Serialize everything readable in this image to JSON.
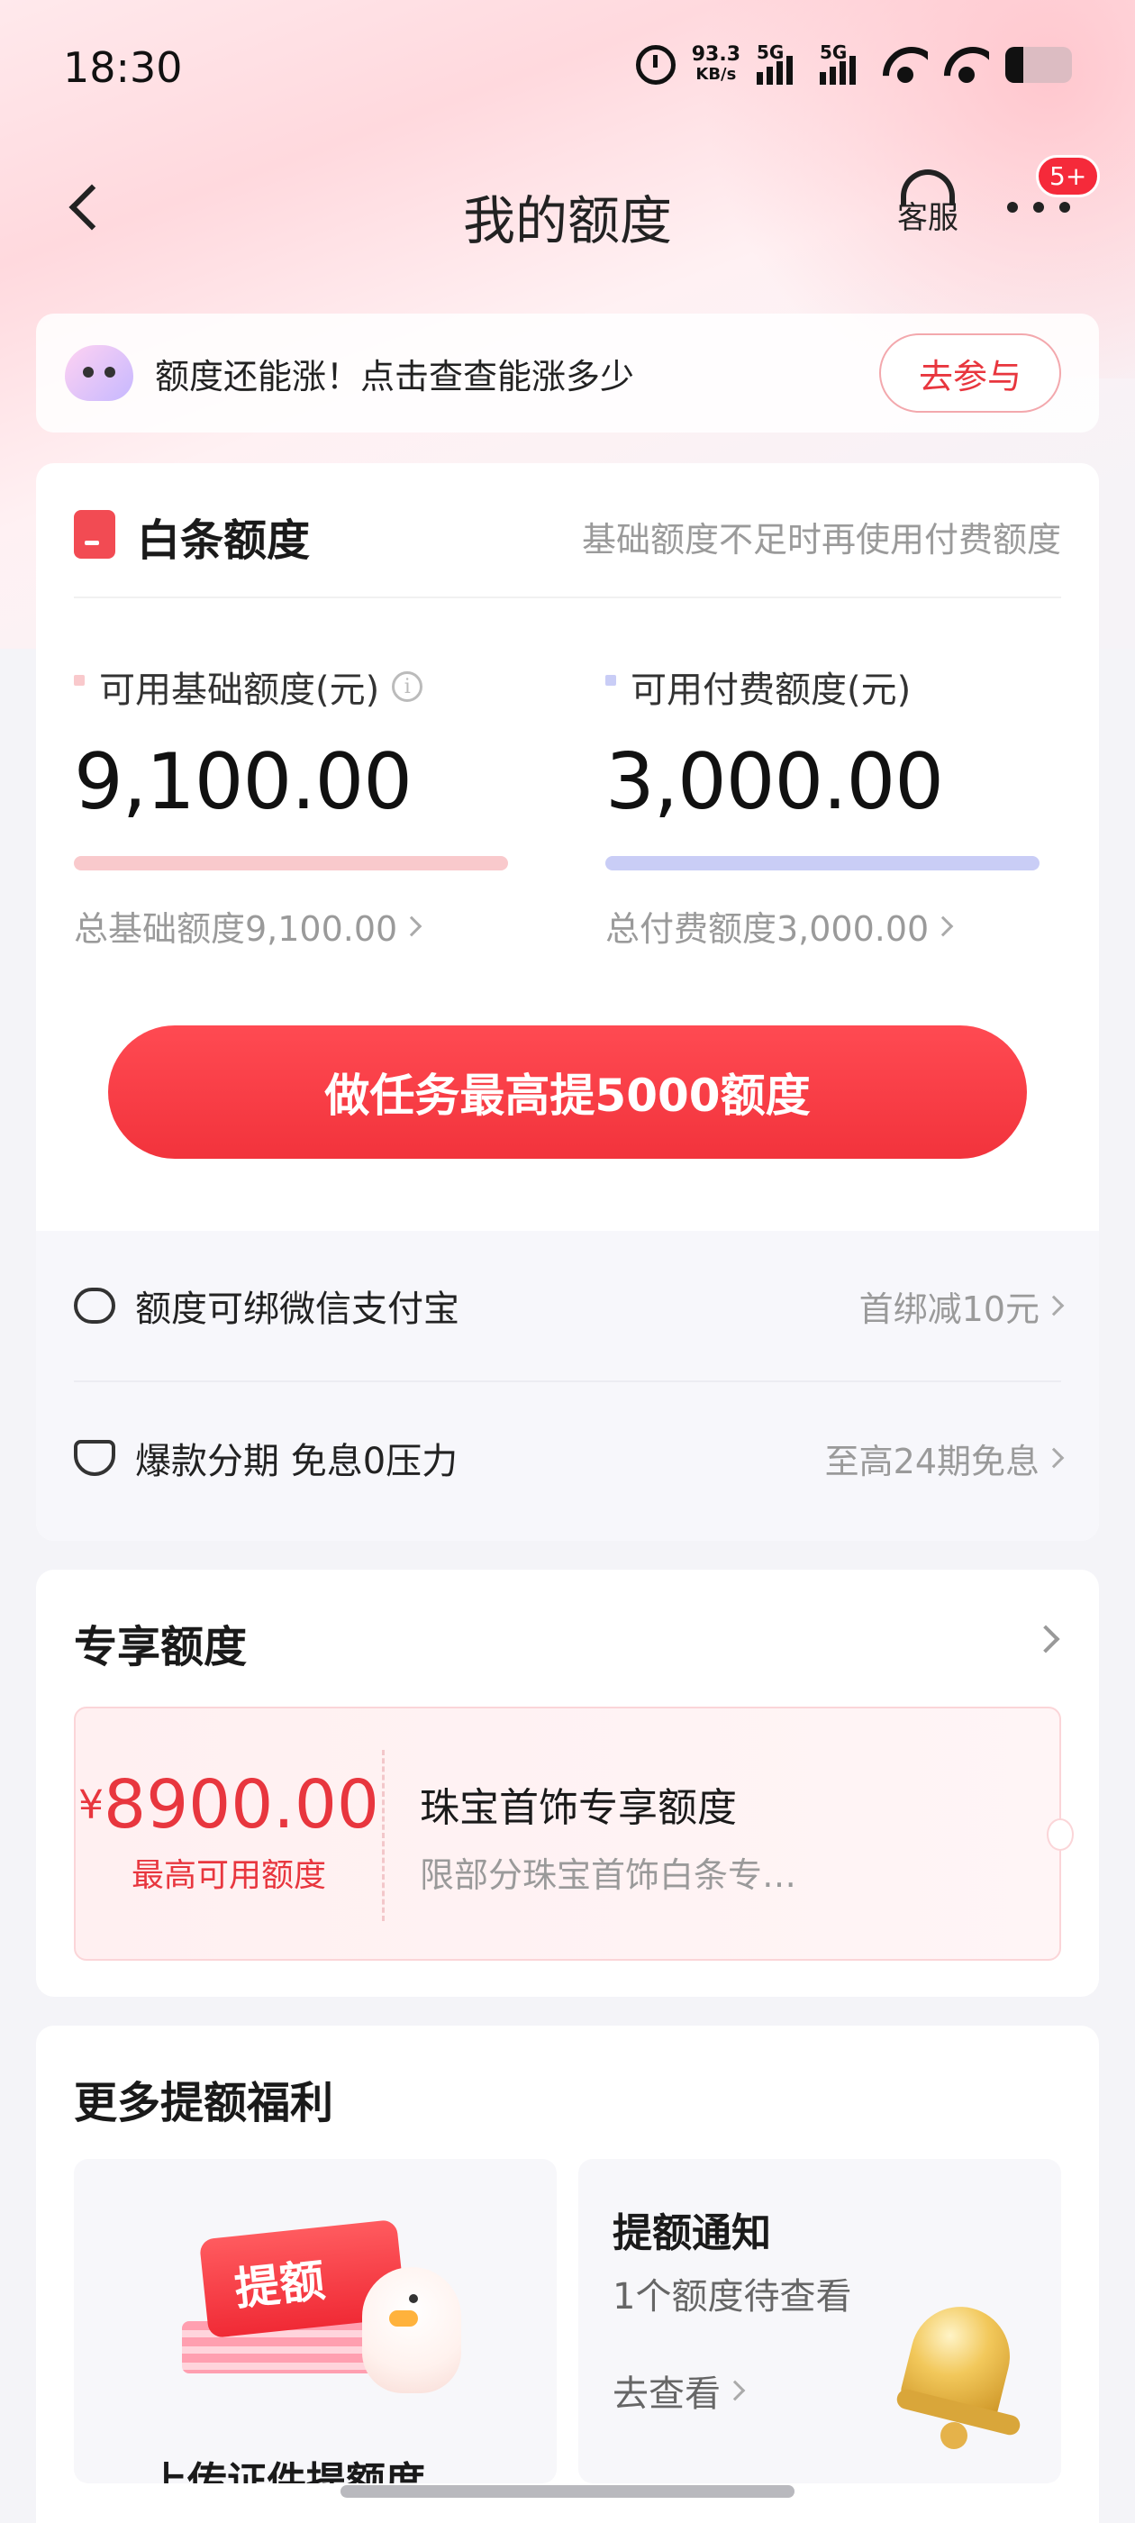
{
  "status_bar": {
    "time": "18:30",
    "speed_value": "93.3",
    "speed_unit": "KB/s",
    "sim1": "5G",
    "sim2": "5G"
  },
  "nav": {
    "title": "我的额度",
    "service_label": "客服",
    "badge": "5+"
  },
  "promo": {
    "text": "额度还能涨！点击查查能涨多少",
    "button": "去参与"
  },
  "baitiao": {
    "title": "白条额度",
    "hint": "基础额度不足时再使用付费额度",
    "basic": {
      "label": "可用基础额度(元)",
      "value": "9,100.00",
      "total": "总基础额度9,100.00",
      "color": "#f9c9cc"
    },
    "paid": {
      "label": "可用付费额度(元)",
      "value": "3,000.00",
      "total": "总付费额度3,000.00",
      "color": "#c9cdf6"
    },
    "task_button": "做任务最高提5000额度",
    "features": [
      {
        "text": "额度可绑微信支付宝",
        "right": "首绑减10元"
      },
      {
        "text": "爆款分期 免息0压力",
        "right": "至高24期免息"
      }
    ]
  },
  "exclusive": {
    "title": "专享额度",
    "coupon": {
      "currency": "¥",
      "amount": "8900.00",
      "sub": "最高可用额度",
      "name": "珠宝首饰专享额度",
      "desc": "限部分珠宝首饰白条专…"
    }
  },
  "more": {
    "title": "更多提额福利",
    "ticket_text": "提额",
    "tile_left_title": "上传证件提额度",
    "notice": {
      "title": "提额通知",
      "sub": "1个额度待查看",
      "link": "去查看"
    }
  },
  "colors": {
    "accent": "#f2333c",
    "accent_text": "#e8363e"
  }
}
